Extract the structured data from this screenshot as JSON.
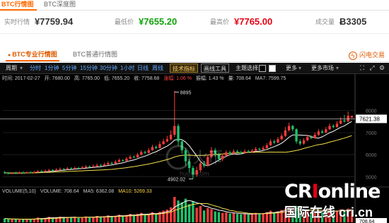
{
  "top_tabs": {
    "active": "BTC行情图",
    "inactive": "BTC深度图"
  },
  "stats": [
    {
      "label": "实时行情",
      "value": "¥7759.94",
      "color": "#333333"
    },
    {
      "label": "最低价",
      "value": "¥7655.20",
      "color": "#13a10e"
    },
    {
      "label": "最高价",
      "value": "¥7765.00",
      "color": "#e60012"
    },
    {
      "label": "成交量",
      "value": "Ƀ3305",
      "color": "#333333"
    }
  ],
  "sub_tabs": {
    "active": "BTC专业行情图",
    "inactive": "BTC普通行情图"
  },
  "flash": {
    "icon": "lightning-icon",
    "label": "闪电交易"
  },
  "toolbar": {
    "period": "周期",
    "intervals": [
      "分时",
      "1分钟",
      "5分钟",
      "15分钟",
      "30分钟",
      "1小时",
      "日线",
      "周线"
    ],
    "tech": "技术指标",
    "draw": "画线工具",
    "theme": "主题选择",
    "more": "更多",
    "more_markets": "更多市场"
  },
  "info": {
    "time": "时间: 2017-02-27",
    "open": "开: 7680.00",
    "high": "高: 7765.00",
    "low": "低: 7655.20",
    "close": "收: 7758.68",
    "change": "涨幅: 1.06 %",
    "amplitude": "振幅: 1.43 %",
    "volume": "量: 708.64",
    "ma7": "MA7: 7599.75"
  },
  "volume_info": {
    "vol_title": "VOLUME(5,10)",
    "vol": "VOLUME: 708.64",
    "ma5": "MA5: 6362.08",
    "ma10": "MA10: 5269.33"
  },
  "annotations": {
    "high": "8895",
    "low": "4902.02",
    "last": "7621.38",
    "vol_last": "708.64"
  },
  "y_axis_ticks": [
    "8000",
    "7000",
    "6000",
    "5000"
  ],
  "watermark": "huobi.com",
  "cri": {
    "logo_a": "CR",
    "logo_b": "I",
    "logo_c": "online",
    "sub": "国际在线 cri.cn"
  },
  "colors": {
    "up": "#ff3b3b",
    "down": "#1fc26b",
    "accent": "#ff6a00"
  },
  "chart_data": {
    "type": "candlestick",
    "y_range": [
      4600,
      9200
    ],
    "candles": [
      [
        5200,
        5180,
        5260,
        5120
      ],
      [
        5180,
        5150,
        5220,
        5100
      ],
      [
        5150,
        5170,
        5210,
        5110
      ],
      [
        5170,
        5160,
        5230,
        5120
      ],
      [
        5160,
        5190,
        5240,
        5130
      ],
      [
        5190,
        5170,
        5250,
        5140
      ],
      [
        5170,
        5200,
        5240,
        5150
      ],
      [
        5200,
        5180,
        5260,
        5150
      ],
      [
        5180,
        5210,
        5270,
        5160
      ],
      [
        5210,
        5250,
        5300,
        5180
      ],
      [
        5250,
        5230,
        5310,
        5200
      ],
      [
        5230,
        5270,
        5330,
        5210
      ],
      [
        5270,
        5300,
        5360,
        5240
      ],
      [
        5300,
        5280,
        5350,
        5240
      ],
      [
        5280,
        5320,
        5390,
        5260
      ],
      [
        5320,
        5350,
        5420,
        5290
      ],
      [
        5350,
        5330,
        5400,
        5300
      ],
      [
        5330,
        5380,
        5440,
        5310
      ],
      [
        5380,
        5360,
        5430,
        5330
      ],
      [
        5360,
        5400,
        5460,
        5340
      ],
      [
        5400,
        5380,
        5450,
        5340
      ],
      [
        5380,
        5420,
        5490,
        5360
      ],
      [
        5420,
        5460,
        5520,
        5400
      ],
      [
        5460,
        5440,
        5510,
        5410
      ],
      [
        5440,
        5480,
        5560,
        5420
      ],
      [
        5480,
        5520,
        5600,
        5460
      ],
      [
        5520,
        5500,
        5580,
        5470
      ],
      [
        5500,
        5560,
        5640,
        5480
      ],
      [
        5560,
        5620,
        5700,
        5530
      ],
      [
        5620,
        5600,
        5690,
        5560
      ],
      [
        5600,
        5680,
        5760,
        5580
      ],
      [
        5680,
        5750,
        5830,
        5650
      ],
      [
        5750,
        5720,
        5800,
        5680
      ],
      [
        5720,
        5820,
        5900,
        5700
      ],
      [
        5820,
        5900,
        5980,
        5780
      ],
      [
        5900,
        5880,
        5960,
        5850
      ],
      [
        5880,
        6000,
        6080,
        5860
      ],
      [
        6000,
        6120,
        6200,
        5960
      ],
      [
        6120,
        6080,
        6180,
        6030
      ],
      [
        6080,
        6200,
        6300,
        6060
      ],
      [
        6200,
        6350,
        6450,
        6180
      ],
      [
        6350,
        6300,
        6420,
        6250
      ],
      [
        6300,
        6480,
        6600,
        6280
      ],
      [
        6480,
        6600,
        6720,
        6450
      ],
      [
        6600,
        6700,
        6850,
        6560
      ],
      [
        6700,
        6900,
        7100,
        6650
      ],
      [
        6900,
        7300,
        8895,
        6800
      ],
      [
        7300,
        6600,
        7400,
        6400
      ],
      [
        6600,
        6200,
        6700,
        6050
      ],
      [
        6200,
        5700,
        6300,
        5500
      ],
      [
        5700,
        5400,
        5800,
        5200
      ],
      [
        5400,
        5100,
        5500,
        4902.02
      ],
      [
        5100,
        5300,
        5450,
        5000
      ],
      [
        5300,
        5600,
        5700,
        5200
      ],
      [
        5600,
        5500,
        5720,
        5420
      ],
      [
        5500,
        5900,
        6000,
        5450
      ],
      [
        5900,
        6200,
        6350,
        5850
      ],
      [
        6200,
        6000,
        6300,
        5900
      ],
      [
        6000,
        5800,
        6100,
        5700
      ],
      [
        5800,
        5950,
        6050,
        5700
      ],
      [
        5950,
        6100,
        6200,
        5900
      ],
      [
        6100,
        6050,
        6180,
        5980
      ],
      [
        6050,
        6150,
        6250,
        6000
      ],
      [
        6150,
        6100,
        6220,
        6050
      ],
      [
        6100,
        6080,
        6180,
        6020
      ],
      [
        6080,
        6150,
        6240,
        6040
      ],
      [
        6150,
        6120,
        6220,
        6080
      ],
      [
        6120,
        6180,
        6260,
        6090
      ],
      [
        6180,
        6260,
        6350,
        6150
      ],
      [
        6260,
        6230,
        6320,
        6180
      ],
      [
        6230,
        6300,
        6400,
        6200
      ],
      [
        6300,
        6420,
        6520,
        6280
      ],
      [
        6420,
        6600,
        6700,
        6400
      ],
      [
        6600,
        6550,
        6680,
        6480
      ],
      [
        6550,
        6700,
        6800,
        6520
      ],
      [
        6700,
        6850,
        6950,
        6650
      ],
      [
        6850,
        7100,
        7250,
        6800
      ],
      [
        7100,
        7300,
        7450,
        7050
      ],
      [
        7300,
        7150,
        7350,
        7050
      ],
      [
        7150,
        6600,
        7200,
        6500
      ],
      [
        6600,
        6500,
        6700,
        6420
      ],
      [
        6500,
        6650,
        6750,
        6450
      ],
      [
        6650,
        6800,
        6900,
        6600
      ],
      [
        6800,
        6750,
        6880,
        6700
      ],
      [
        6750,
        6900,
        7000,
        6720
      ],
      [
        6900,
        7050,
        7150,
        6850
      ],
      [
        7050,
        7000,
        7130,
        6950
      ],
      [
        7000,
        7150,
        7250,
        6980
      ],
      [
        7150,
        7300,
        7420,
        7100
      ],
      [
        7300,
        7250,
        7380,
        7200
      ],
      [
        7250,
        7400,
        7520,
        7220
      ],
      [
        7400,
        7550,
        7700,
        7380
      ],
      [
        7550,
        7500,
        7800,
        7450
      ],
      [
        7500,
        7760,
        7950,
        7480
      ],
      [
        7680,
        7758.68,
        7765,
        7655.2
      ]
    ],
    "volumes": [
      210,
      180,
      160,
      170,
      150,
      190,
      175,
      160,
      200,
      260,
      230,
      240,
      300,
      220,
      280,
      310,
      250,
      290,
      260,
      300,
      240,
      280,
      320,
      260,
      300,
      350,
      280,
      330,
      380,
      300,
      360,
      420,
      330,
      410,
      460,
      360,
      470,
      520,
      400,
      480,
      560,
      430,
      580,
      640,
      700,
      820,
      1400,
      1200,
      1100,
      1300,
      1000,
      1150,
      800,
      900,
      650,
      780,
      720,
      600,
      560,
      520,
      540,
      480,
      500,
      460,
      440,
      470,
      430,
      480,
      520,
      460,
      500,
      560,
      640,
      540,
      600,
      680,
      760,
      820,
      640,
      900,
      620,
      580,
      640,
      560,
      600,
      660,
      560,
      620,
      680,
      580,
      640,
      720,
      660,
      760,
      708.64
    ]
  }
}
